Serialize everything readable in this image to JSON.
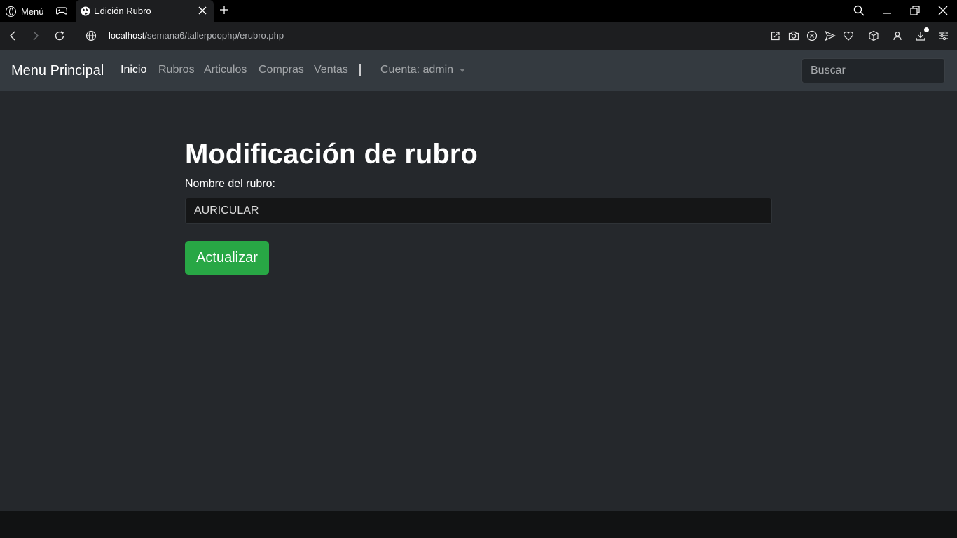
{
  "browser": {
    "menu_label": "Menú",
    "tab_title": "Edición Rubro",
    "url_host": "localhost",
    "url_path": "/semana6/tallerpoophp/erubro.php"
  },
  "navbar": {
    "brand": "Menu Principal",
    "links": [
      {
        "label": "Inicio",
        "active": true
      },
      {
        "label": "Rubros",
        "active": false
      },
      {
        "label": "Articulos",
        "active": false
      },
      {
        "label": "Compras",
        "active": false
      },
      {
        "label": "Ventas",
        "active": false
      }
    ],
    "account": "Cuenta: admin",
    "search_placeholder": "Buscar"
  },
  "form": {
    "title": "Modificación de rubro",
    "label": "Nombre del rubro:",
    "value": "AURICULAR",
    "submit": "Actualizar"
  },
  "colors": {
    "navbar_bg": "#343a40",
    "content_bg": "#25282c",
    "button_green": "#28a745"
  }
}
